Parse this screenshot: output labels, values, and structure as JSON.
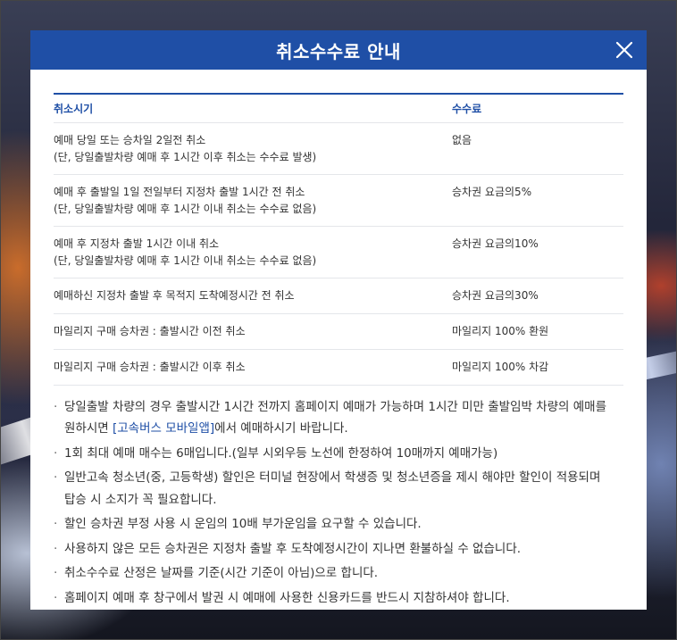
{
  "modal": {
    "title": "취소수수료 안내",
    "close_icon": "close-icon"
  },
  "table": {
    "headers": [
      "취소시기",
      "수수료"
    ],
    "rows": [
      {
        "when_line1": "예매 당일 또는 승차일 2일전 취소",
        "when_line2": "(단, 당일출발차량 예매 후 1시간 이후 취소는 수수료 발생)",
        "fee": "없음"
      },
      {
        "when_line1": "예매 후 출발일 1일 전일부터 지정차 출발 1시간 전 취소",
        "when_line2": "(단, 당일출발차량 예매 후 1시간 이내 취소는 수수료 없음)",
        "fee": "승차권 요금의5%"
      },
      {
        "when_line1": "예매 후 지정차 출발 1시간 이내 취소",
        "when_line2": "(단, 당일출발차량 예매 후 1시간 이내 취소는 수수료 없음)",
        "fee": "승차권 요금의10%"
      },
      {
        "when_line1": "예매하신 지정차 출발 후 목적지 도착예정시간 전 취소",
        "fee": "승차권 요금의30%"
      },
      {
        "when_line1": "마일리지 구매 승차권 : 출발시간 이전 취소",
        "fee": "마일리지 100% 환원"
      },
      {
        "when_line1": "마일리지 구매 승차권 : 출발시간 이후 취소",
        "fee": "마일리지 100% 차감"
      }
    ]
  },
  "notes": {
    "n1_before": "당일출발 차량의 경우 출발시간 1시간 전까지 홈페이지 예매가 가능하며 1시간 미만 출발임박 차량의 예매를 원하시면 ",
    "n1_link": "[고속버스 모바일앱]",
    "n1_after": "에서 예매하시기 바랍니다.",
    "n2": "1회 최대 예매 매수는 6매입니다.(일부 시외우등 노선에 한정하여 10매까지 예매가능)",
    "n3": "일반고속 청소년(중, 고등학생) 할인은 터미널 현장에서 학생증 및 청소년증을 제시 해야만 할인이 적용되며 탑승 시 소지가 꼭 필요합니다.",
    "n4": "할인 승차권 부정 사용 시 운임의 10배 부가운임을 요구할 수 있습니다.",
    "n5": "사용하지 않은 모든 승차권은 지정차 출발 후 도착예정시간이 지나면 환불하실 수 없습니다.",
    "n6": "취소수수료 산정은 날짜를 기준(시간 기준이 아님)으로 합니다.",
    "n7": "홈페이지 예매 후 창구에서 발권 시 예매에 사용한 신용카드를 반드시 지참하셔야 합니다."
  },
  "colors": {
    "header_bg": "#1f4fa6",
    "accent_text": "#1f4fa6",
    "body_text": "#333333"
  }
}
